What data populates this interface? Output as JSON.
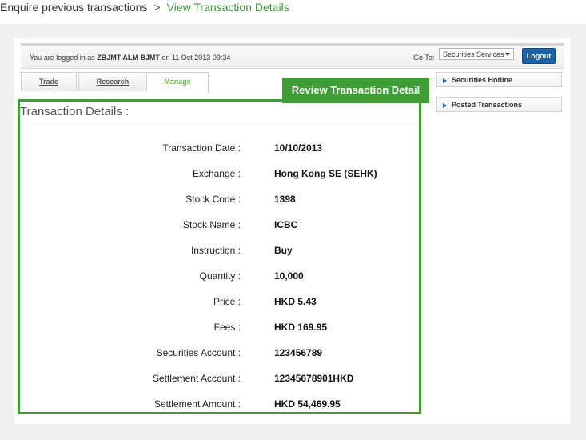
{
  "breadcrumb": {
    "parent": "Enquire previous transactions",
    "separator": ">",
    "current": "View Transaction Details"
  },
  "topbar": {
    "login_prefix": "You are logged in as",
    "user_name": "ZBJMT ALM BJMT",
    "login_suffix": "on 11 Oct 2013 09:34",
    "goto_label": "Go To:",
    "goto_selected": "Securities Services",
    "logout_label": "Logout"
  },
  "tabs": [
    {
      "label": "Trade"
    },
    {
      "label": "Research"
    },
    {
      "label": "Manage"
    }
  ],
  "side_links": [
    {
      "label": "Securities Hotline"
    },
    {
      "label": "Posted Transactions"
    }
  ],
  "callout": "Review Transaction Detail",
  "details": {
    "title": "Transaction Details :",
    "rows": [
      {
        "label": "Transaction Date :",
        "value": "10/10/2013"
      },
      {
        "label": "Exchange :",
        "value": "Hong Kong SE (SEHK)"
      },
      {
        "label": "Stock Code :",
        "value": "1398"
      },
      {
        "label": "Stock Name :",
        "value": "ICBC"
      },
      {
        "label": "Instruction :",
        "value": "Buy"
      },
      {
        "label": "Quantity :",
        "value": "10,000"
      },
      {
        "label": "Price :",
        "value": "HKD 5.43"
      },
      {
        "label": "Fees :",
        "value": "HKD 169.95"
      },
      {
        "label": "Securities Account :",
        "value": "123456789"
      },
      {
        "label": "Settlement Account :",
        "value": "12345678901HKD"
      },
      {
        "label": "Settlement Amount :",
        "value": "HKD 54,469.95"
      }
    ]
  },
  "colors": {
    "accent_green": "#3f9d36",
    "breadcrumb_green": "#3c9a3a",
    "logout_blue": "#1c62a8"
  }
}
